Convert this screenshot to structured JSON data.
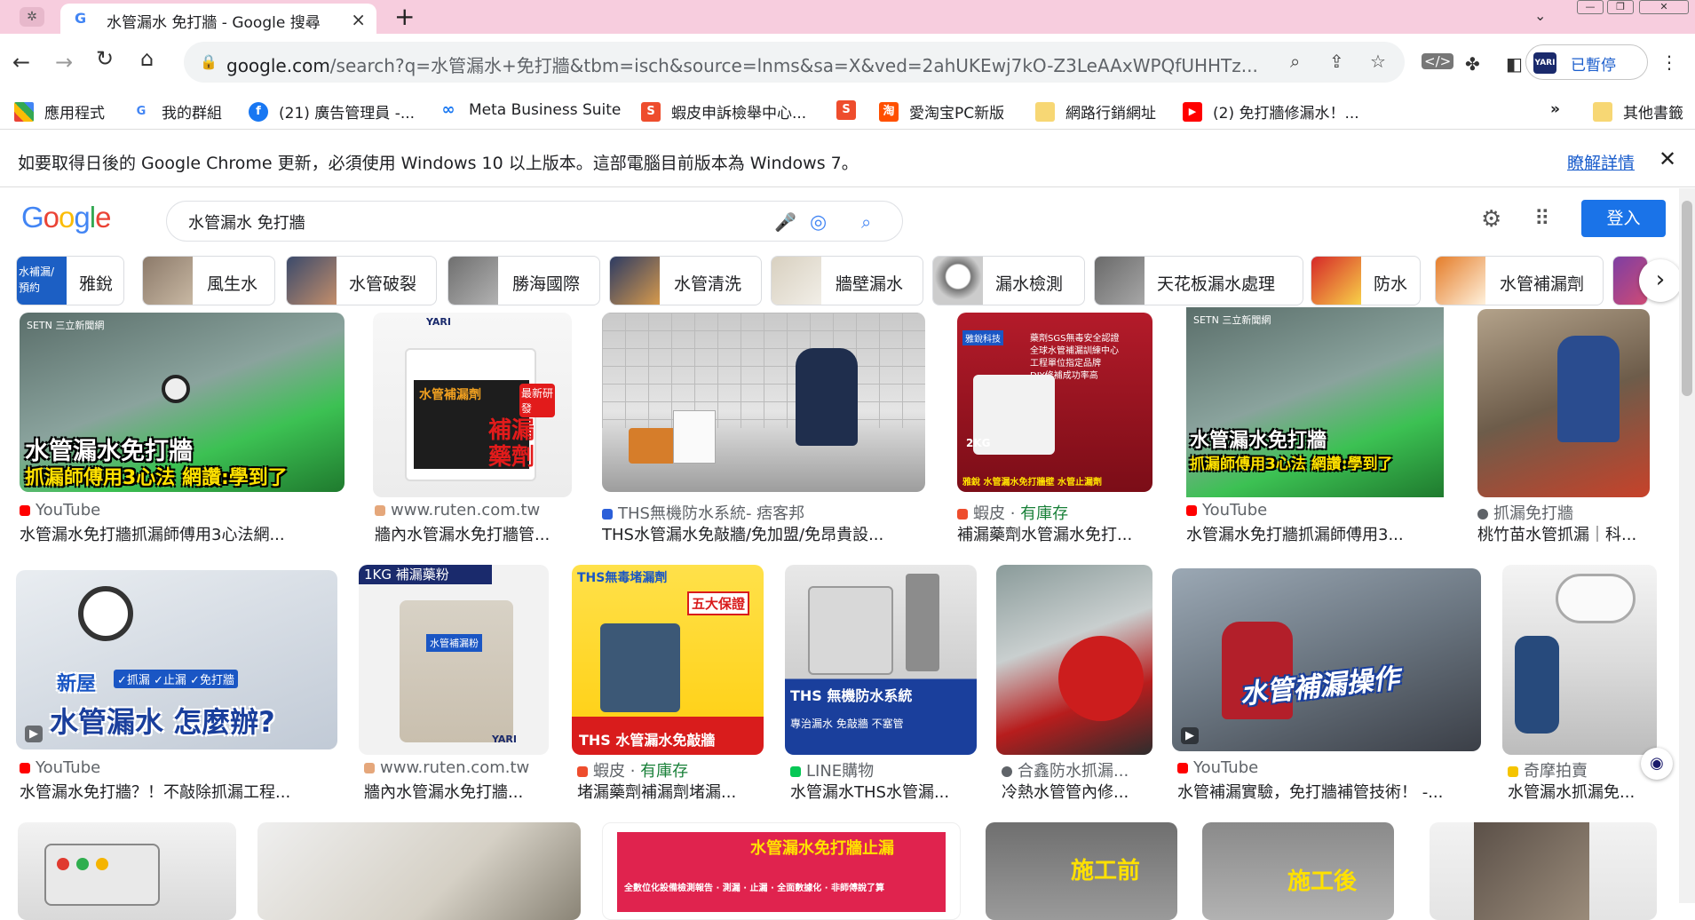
{
  "tab": {
    "title": "水管漏水 免打牆 - Google 搜尋",
    "close": "×",
    "new_tab": "+",
    "favicon": "G"
  },
  "window": {
    "menu": "⌄"
  },
  "toolbar": {
    "url_host": "google.com",
    "url_path": "/search?q=水管漏水+免打牆&tbm=isch&source=lnms&sa=X&ved=2ahUKEwj7kO-Z3LeAAxWPQfUHHTz...",
    "profile_badge": "YARI",
    "profile_label": "已暫停"
  },
  "bookmarks": [
    {
      "label": "應用程式",
      "icon": "apps-grid-icon"
    },
    {
      "label": "我的群組",
      "icon": "google-icon"
    },
    {
      "label": "(21) 廣告管理員 -...",
      "icon": "facebook-icon"
    },
    {
      "label": "Meta Business Suite",
      "icon": "meta-icon"
    },
    {
      "label": "蝦皮申訴檢舉中心...",
      "icon": "shopee-icon"
    },
    {
      "label": "",
      "icon": "shopee-icon"
    },
    {
      "label": "愛淘宝PC新版",
      "icon": "taobao-icon"
    },
    {
      "label": "網路行銷網址",
      "icon": "folder-icon"
    },
    {
      "label": "(2) 免打牆修漏水！...",
      "icon": "youtube-icon"
    },
    {
      "label": "其他書籤",
      "icon": "folder-icon"
    }
  ],
  "bookmarks_more": "»",
  "infobar": {
    "message": "如要取得日後的 Google Chrome 更新，必須使用 Windows 10 以上版本。這部電腦目前版本為 Windows 7。",
    "link": "瞭解詳情",
    "close": "✕"
  },
  "google": {
    "logo": "Google",
    "query": "水管漏水 免打牆",
    "signin": "登入"
  },
  "chips": [
    {
      "label": "雅銳",
      "thumb_text": "水補漏/預約"
    },
    {
      "label": "風生水"
    },
    {
      "label": "水管破裂"
    },
    {
      "label": "勝海國際"
    },
    {
      "label": "水管清洗"
    },
    {
      "label": "牆壁漏水"
    },
    {
      "label": "漏水檢測"
    },
    {
      "label": "天花板漏水處理"
    },
    {
      "label": "防水"
    },
    {
      "label": "水管補漏劑"
    }
  ],
  "chip_next": "›",
  "row1": [
    {
      "source": "YouTube",
      "caption": "水管漏水免打牆抓漏師傅用3心法網...",
      "overlay1": "水管漏水免打牆",
      "overlay2": "抓漏師傅用3心法 網讚:學到了",
      "corner": "SETN 三立新聞網",
      "src_color": "#ff0000"
    },
    {
      "source": "www.ruten.com.tw",
      "caption": "牆內水管漏水免打牆管...",
      "overlay1": "水管補漏劑",
      "overlay2": "補漏藥劑",
      "overlay3": "最新研發",
      "corner": "YARI",
      "src_color": "#e5a77b"
    },
    {
      "source": "THS無機防水系統- 痞客邦",
      "caption": "THS水管漏水免敲牆/免加盟/免昂貴設...",
      "src_color": "#2b5fd9"
    },
    {
      "source_prefix": "蝦皮 · ",
      "source": "有庫存",
      "caption": "補漏藥劑水管漏水免打...",
      "overlay1": "藥劑SGS無毒安全認證",
      "overlay2": "全球水管補漏訓練中心",
      "overlay3": "工程單位指定品牌",
      "overlay4": "DIY修補成功率高",
      "overlay5": "雅銳 水管漏水免打牆壁 水管止漏劑",
      "corner": "雅銳科技",
      "weight": "2KG",
      "src_color": "#ee4d2d"
    },
    {
      "source": "YouTube",
      "caption": "水管漏水免打牆抓漏師傅用3...",
      "overlay1": "水管漏水免打牆",
      "overlay2": "抓漏師傅用3心法 網讚:學到了",
      "corner": "SETN 三立新聞網",
      "src_color": "#ff0000"
    },
    {
      "source": "抓漏免打牆",
      "caption": "桃竹苗水管抓漏｜科...",
      "src_color": "#5f6368"
    }
  ],
  "row2": [
    {
      "source": "YouTube",
      "caption": "水管漏水免打牆？！不敲除抓漏工程...",
      "overlay1": "新屋",
      "overlay2": "水管漏水 怎麼辦?",
      "tags": "✓抓漏 ✓止漏 ✓免打牆",
      "src_color": "#ff0000"
    },
    {
      "source": "www.ruten.com.tw",
      "caption": "牆內水管漏水免打牆...",
      "overlay1": "1KG 補漏藥粉",
      "inner": "水管補漏粉",
      "corner": "YARI",
      "src_color": "#e5a77b"
    },
    {
      "source_prefix": "蝦皮 · ",
      "source": "有庫存",
      "caption": "堵漏藥劑補漏劑堵漏...",
      "overlay1": "THS無毒堵漏劑",
      "overlay2": "THS 水管漏水免敲牆",
      "badge": "五大保證",
      "src_color": "#ee4d2d"
    },
    {
      "source": "LINE購物",
      "caption": "水管漏水THS水管漏...",
      "overlay1": "THS 無機防水系統",
      "overlay2": "專治漏水  免敲牆  不塞管",
      "src_color": "#06c755"
    },
    {
      "source": "合鑫防水抓漏...",
      "caption": "冷熱水管管內修...",
      "src_color": "#5f6368"
    },
    {
      "source": "YouTube",
      "caption": "水管補漏實驗，免打牆補管技術！ -...",
      "overlay1": "水管補漏操作",
      "src_color": "#ff0000"
    },
    {
      "source": "奇摩拍賣",
      "caption": "水管漏水抓漏免...",
      "src_color": "#f5c400"
    }
  ],
  "row3": [
    {
      "overlay1": ""
    },
    {
      "overlay1": ""
    },
    {
      "overlay1": "水管漏水免打牆止漏",
      "overlay2": "全數位化設備檢測報告 · 測漏 · 止漏 · 全面數據化 · 非師傅說了算"
    },
    {
      "overlay1": "施工前"
    },
    {
      "overlay1": "施工後"
    },
    {
      "overlay1": ""
    }
  ]
}
